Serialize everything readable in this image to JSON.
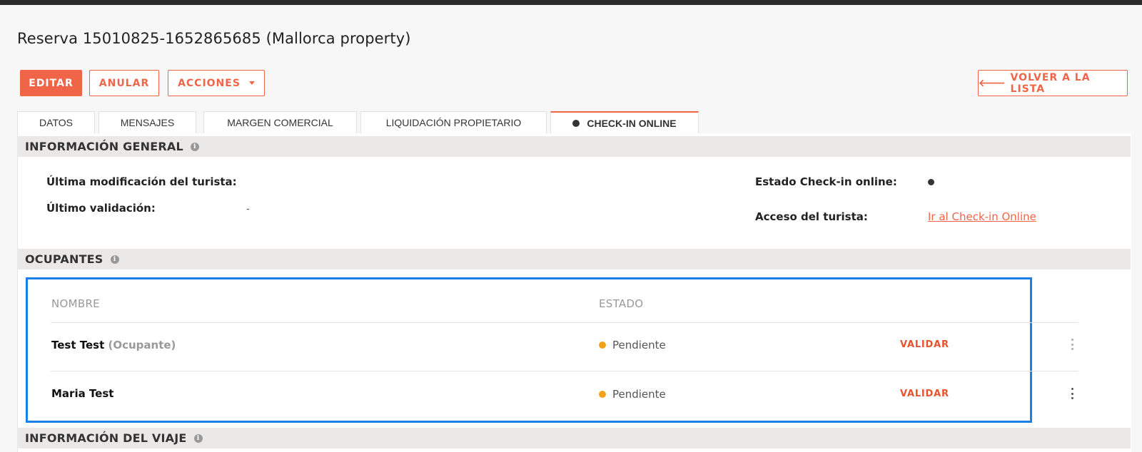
{
  "page": {
    "title": "Reserva 15010825-1652865685 (Mallorca property)"
  },
  "toolbar": {
    "edit_label": "EDITAR",
    "cancel_label": "ANULAR",
    "actions_label": "ACCIONES",
    "back_label": "VOLVER A LA LISTA",
    "back_icon": "arrow-left-icon"
  },
  "tabs": [
    {
      "label": "DATOS",
      "active": false
    },
    {
      "label": "MENSAJES",
      "active": false
    },
    {
      "label": "MARGEN COMERCIAL",
      "active": false
    },
    {
      "label": "LIQUIDACIÓN PROPIETARIO",
      "active": false
    },
    {
      "label": "CHECK-IN ONLINE",
      "active": true
    }
  ],
  "general": {
    "header": "INFORMACIÓN GENERAL",
    "last_modified_label": "Última modificación del turista:",
    "last_modified_value": "",
    "last_validation_label": "Último validación:",
    "last_validation_value": "-",
    "checkin_state_label": "Estado Check-in online:",
    "tourist_access_label": "Acceso del turista:",
    "tourist_access_link": "Ir al Check-in Online"
  },
  "occupants": {
    "header": "OCUPANTES",
    "columns": {
      "name": "NOMBRE",
      "status": "ESTADO"
    },
    "rows": [
      {
        "name": "Test Test",
        "role": "(Ocupante)",
        "status": "Pendiente",
        "action": "VALIDAR"
      },
      {
        "name": "Maria Test",
        "role": "",
        "status": "Pendiente",
        "action": "VALIDAR"
      }
    ]
  },
  "trip": {
    "header": "INFORMACIÓN DEL VIAJE"
  },
  "colors": {
    "accent": "#f06548",
    "pending": "#f5a21b",
    "highlight": "#1a7fe8",
    "section_bg": "#ebe8e8"
  }
}
